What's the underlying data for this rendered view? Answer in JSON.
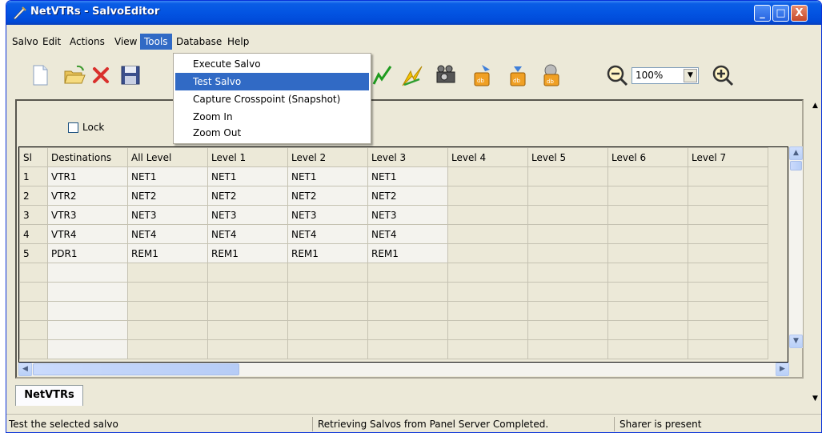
{
  "window": {
    "title": "NetVTRs - SalvoEditor",
    "controls": [
      "_",
      "□",
      "X"
    ]
  },
  "menubar": {
    "items": [
      "Salvo",
      "Edit",
      "Actions",
      "View",
      "Tools",
      "Database",
      "Help"
    ],
    "active": "Tools"
  },
  "tools_menu": {
    "items": [
      "Execute Salvo",
      "Test Salvo",
      "Capture Crosspoint (Snapshot)",
      "Zoom In",
      "Zoom Out"
    ],
    "highlighted": "Test Salvo"
  },
  "toolbar": {
    "icons": [
      "new-document-icon",
      "open-folder-icon",
      "delete-icon",
      "save-icon",
      "green-check-icon",
      "yellow-arrow-icon",
      "camera-icon",
      "database-upload-icon",
      "database-download-icon",
      "database-settings-icon",
      "zoom-out-icon",
      "zoom-in-icon"
    ],
    "zoom_value": "100%"
  },
  "lock": {
    "label": "Lock",
    "checked": false
  },
  "grid": {
    "headers": [
      "Sl",
      "Destinations",
      "All Level",
      "Level 1",
      "Level 2",
      "Level 3",
      "Level 4",
      "Level 5",
      "Level 6",
      "Level 7"
    ],
    "rows": [
      [
        "1",
        "VTR1",
        "NET1",
        "NET1",
        "NET1",
        "NET1"
      ],
      [
        "2",
        "VTR2",
        "NET2",
        "NET2",
        "NET2",
        "NET2"
      ],
      [
        "3",
        "VTR3",
        "NET3",
        "NET3",
        "NET3",
        "NET3"
      ],
      [
        "4",
        "VTR4",
        "NET4",
        "NET4",
        "NET4",
        "NET4"
      ],
      [
        "5",
        "PDR1",
        "REM1",
        "REM1",
        "REM1",
        "REM1"
      ]
    ],
    "blank_rows": 5
  },
  "tabs": [
    "NetVTRs"
  ],
  "status": {
    "left": "Test the selected salvo",
    "middle": "Retrieving Salvos from Panel Server Completed.",
    "right": "Sharer is present"
  },
  "colors": {
    "titlebar": "#0354e2",
    "menu_highlight": "#316ac5",
    "face": "#ece9d8"
  }
}
